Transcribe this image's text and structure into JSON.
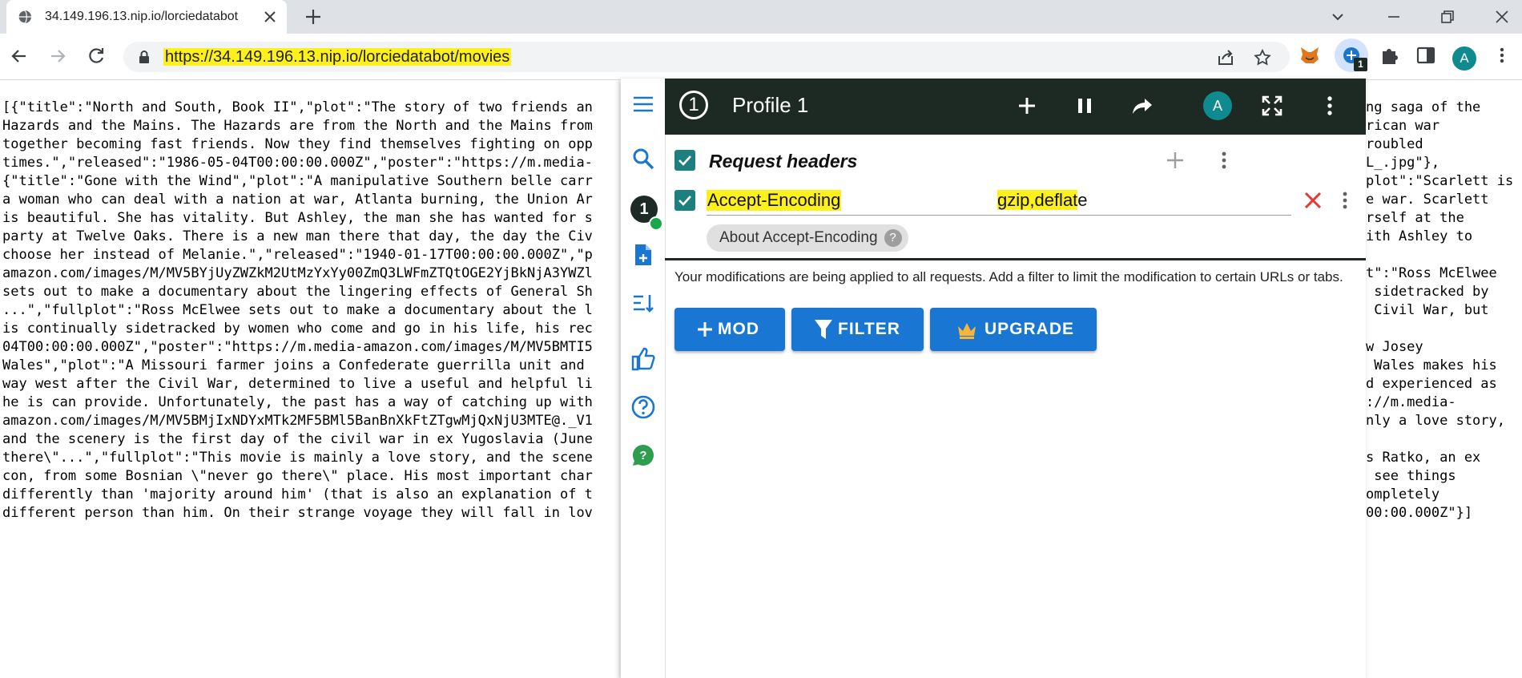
{
  "browser": {
    "tab_title": "34.149.196.13.nip.io/lorciedatabot",
    "url": "https://34.149.196.13.nip.io/lorciedatabot/movies",
    "avatar_letter": "A",
    "extension_badge": "1"
  },
  "page": {
    "lines": [
      "[{\"title\":\"North and South, Book II\",\"plot\":\"The story of two friends an",
      "Hazards and the Mains. The Hazards are from the North and the Mains from",
      "together becoming fast friends. Now they find themselves fighting on opp",
      "times.\",\"released\":\"1986-05-04T00:00:00.000Z\",\"poster\":\"https://m.media-",
      "{\"title\":\"Gone with the Wind\",\"plot\":\"A manipulative Southern belle carr",
      "a woman who can deal with a nation at war, Atlanta burning, the Union Ar",
      "is beautiful. She has vitality. But Ashley, the man she has wanted for s",
      "party at Twelve Oaks. There is a new man there that day, the day the Civ",
      "choose her instead of Melanie.\",\"released\":\"1940-01-17T00:00:00.000Z\",\"p",
      "amazon.com/images/M/MV5BYjUyZWZkM2UtMzYxYy00ZmQ3LWFmZTQtOGE2YjBkNjA3YWZl",
      "sets out to make a documentary about the lingering effects of General Sh",
      "...\",\"fullplot\":\"Ross McElwee sets out to make a documentary about the l",
      "is continually sidetracked by women who come and go in his life, his rec",
      "04T00:00:00.000Z\",\"poster\":\"https://m.media-amazon.com/images/M/MV5BMTI5",
      "Wales\",\"plot\":\"A Missouri farmer joins a Confederate guerrilla unit and",
      "way west after the Civil War, determined to live a useful and helpful li",
      "he is can provide. Unfortunately, the past has a way of catching up with",
      "amazon.com/images/M/MV5BMjIxNDYxMTk2MF5BMl5BanBnXkFtZTgwMjQxNjU3MTE@._V1",
      "and the scenery is the first day of the civil war in ex Yugoslavia (June",
      "there\\\"...\",\"fullplot\":\"This movie is mainly a love story, and the scene",
      "con, from some Bosnian \\\"never go there\\\" place. His most important char",
      "differently than 'majority around him' (that is also an explanation of t",
      "different person than him. On their strange voyage they will fall in lov"
    ],
    "right_lines": [
      "ng saga of the",
      "rican war",
      "roubled",
      "L_.jpg\"},",
      "plot\":\"Scarlett is",
      "e war. Scarlett",
      "rself at the",
      "ith Ashley to",
      "",
      "t\":\"Ross McElwee",
      " sidetracked by",
      " Civil War, but",
      "",
      "w Josey",
      " Wales makes his",
      "d experienced as",
      "://m.media-",
      "nly a love story,",
      "",
      "s Ratko, an ex",
      " see things",
      "ompletely",
      "00:00.000Z\"}]"
    ]
  },
  "popup": {
    "profile_number": "1",
    "profile_title": "Profile 1",
    "header_avatar": "A",
    "section_title": "Request headers",
    "header_name": "Accept-Encoding",
    "header_value_highlighted": "gzip,deflat",
    "header_value_rest": "e",
    "about_chip": "About Accept-Encoding",
    "about_chip_icon": "?",
    "notice": "Your modifications are being applied to all requests. Add a filter to limit the modification to certain URLs or tabs.",
    "buttons": {
      "mod": "MOD",
      "filter": "FILTER",
      "upgrade": "UPGRADE"
    },
    "rail_badge": "1"
  },
  "colors": {
    "header_bg": "#1c2a23",
    "accent_teal": "#1d7f7f",
    "button_blue": "#1976d2",
    "highlight": "#fef01b",
    "delete_red": "#e53935"
  }
}
